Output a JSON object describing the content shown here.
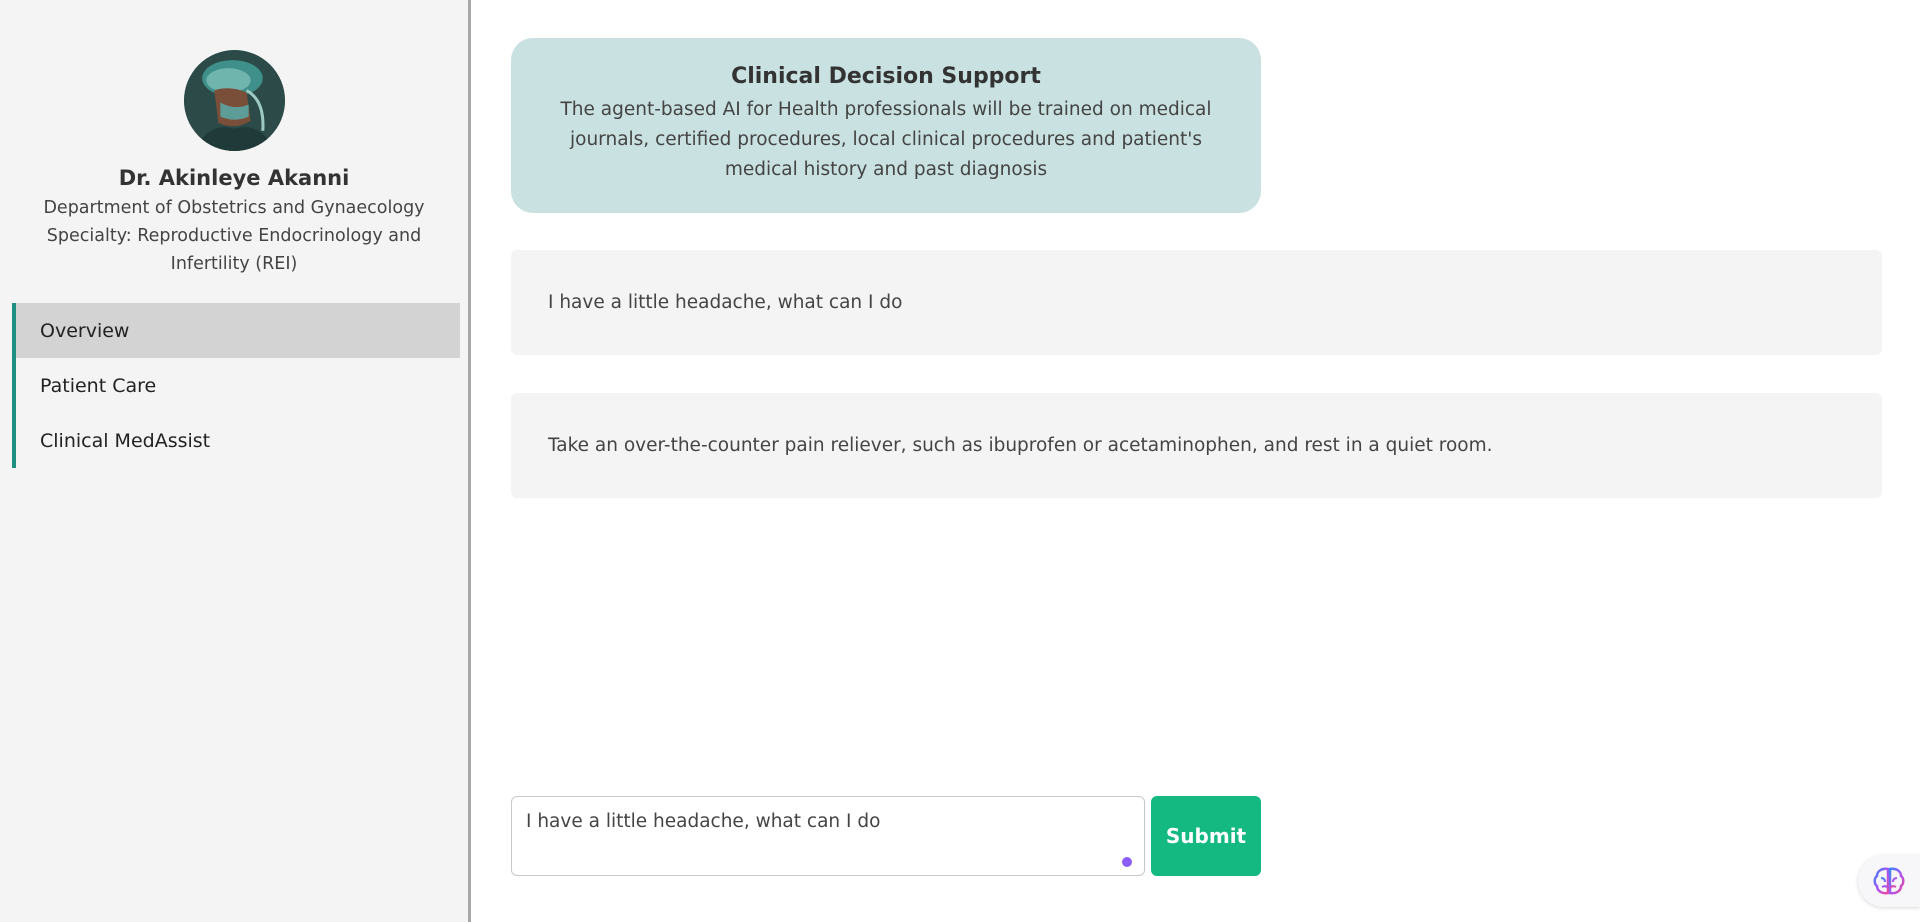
{
  "sidebar": {
    "doctor_name": "Dr. Akinleye Akanni",
    "department": "Department of Obstetrics and Gynaecology",
    "specialty": "Specialty: Reproductive Endocrinology and Infertility (REI)",
    "nav": [
      {
        "label": "Overview",
        "active": true
      },
      {
        "label": "Patient Care",
        "active": false
      },
      {
        "label": "Clinical MedAssist",
        "active": false
      }
    ]
  },
  "info_card": {
    "title": "Clinical Decision Support",
    "text": "The agent-based AI for Health professionals will be trained on medical journals, certified procedures, local clinical procedures and patient's medical history and past diagnosis"
  },
  "chat": {
    "messages": [
      {
        "role": "user",
        "text": "I have a little headache, what can I do"
      },
      {
        "role": "assistant",
        "text": "Take an over-the-counter pain reliever, such as ibuprofen or acetaminophen, and rest in a quiet room."
      }
    ]
  },
  "composer": {
    "value": "I have a little headache, what can I do",
    "submit_label": "Submit"
  },
  "colors": {
    "accent": "#13b981",
    "card_bg": "#c9e1e1",
    "nav_border": "#1f8f82",
    "active_nav_bg": "#d3d3d3"
  },
  "icons": {
    "avatar": "doctor-avatar",
    "assistant_fab": "brain-icon"
  }
}
